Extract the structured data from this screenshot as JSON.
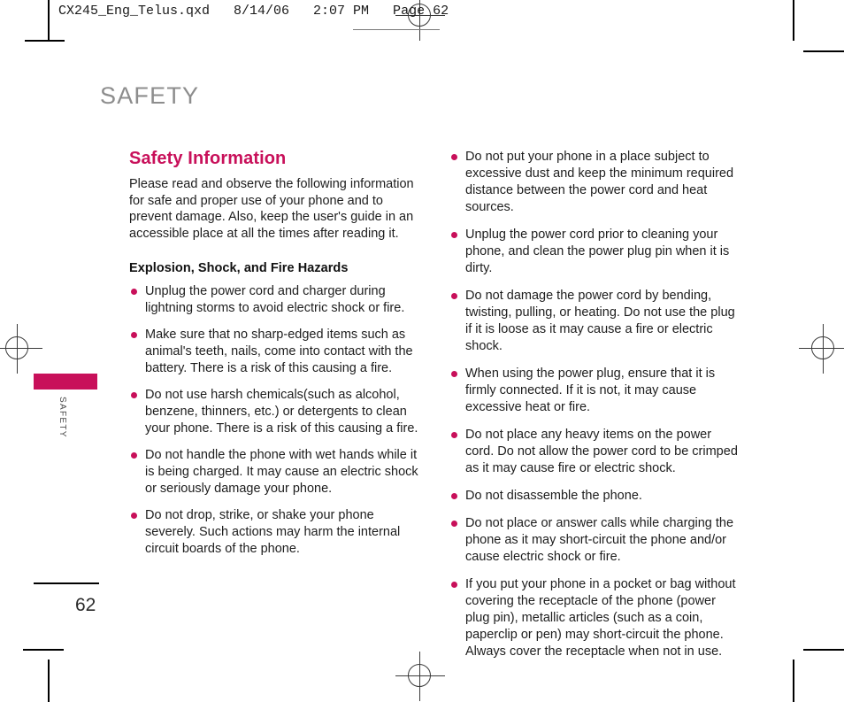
{
  "prepress": {
    "file_slug": "CX245_Eng_Telus.qxd   8/14/06   2:07 PM   Page 62"
  },
  "running_head": "SAFETY",
  "side_tab": {
    "label": "SAFETY",
    "color": "#c8105a"
  },
  "folio": {
    "page_number": "62"
  },
  "colors": {
    "accent": "#c8105a",
    "running_head": "#8d8d8d",
    "body_text": "#1d1d1d"
  },
  "left_column": {
    "section_title": "Safety Information",
    "intro": "Please read and observe the following information for safe and proper use of your phone and to prevent damage. Also, keep the user's guide in an accessible place at all the times after reading it.",
    "sub_title": "Explosion, Shock, and Fire Hazards",
    "bullets": [
      "Unplug the power cord and charger during lightning storms to avoid electric shock or fire.",
      "Make sure that no sharp-edged items such as animal's teeth, nails, come into contact with the battery. There is a risk of this causing a fire.",
      "Do not use harsh chemicals(such as alcohol, benzene, thinners, etc.) or detergents to clean your phone. There is a risk of this causing a fire.",
      "Do not handle the phone with wet hands while it is being charged. It may cause an electric shock or seriously damage your phone.",
      "Do not drop, strike, or shake your phone severely. Such actions may harm the internal circuit boards of the phone."
    ]
  },
  "right_column": {
    "bullets": [
      "Do not put your phone in a place subject to excessive dust and keep the minimum required distance between the power cord and heat sources.",
      "Unplug the power cord prior to cleaning your phone, and clean the power plug pin when it is dirty.",
      "Do not damage the power cord by bending, twisting, pulling, or heating. Do not use the plug if it is loose as it may cause a fire or electric shock.",
      "When using the power plug, ensure that it is firmly connected. If it is not, it may cause excessive heat or fire.",
      "Do not place any heavy items on the power cord. Do not allow the power cord to be crimped as it may cause fire or electric shock.",
      "Do not disassemble the phone.",
      "Do not place or answer calls while charging the phone as it may short-circuit the phone and/or cause electric shock or fire.",
      "If you put your phone in a pocket or bag without covering the receptacle of the phone (power plug pin), metallic articles (such as a coin, paperclip or pen) may short-circuit the phone. Always cover the receptacle when not in use."
    ]
  }
}
